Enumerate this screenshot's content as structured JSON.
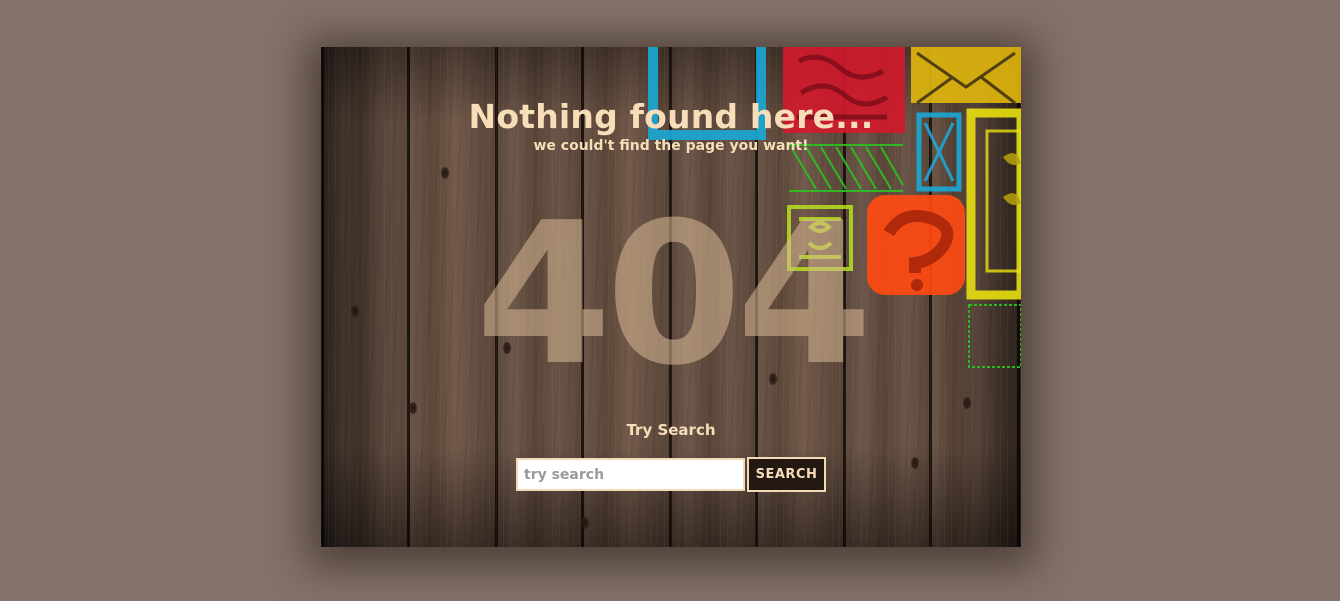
{
  "page": {
    "title": "Nothing found here...",
    "subtitle": "we could't find the page you want!",
    "error_code": "404"
  },
  "search": {
    "label": "Try Search",
    "placeholder": "try search",
    "value": "",
    "button_label": "SEARCH"
  },
  "colors": {
    "background": "#83736a",
    "text": "#f7deb9",
    "button_bg": "#241812",
    "graffiti_red": "#d3192c",
    "graffiti_blue": "#1aa8d6",
    "graffiti_yellow": "#e2b80d",
    "graffiti_orange": "#ff4a12",
    "graffiti_green": "#2bc41f",
    "graffiti_lime": "#b8e01e"
  }
}
